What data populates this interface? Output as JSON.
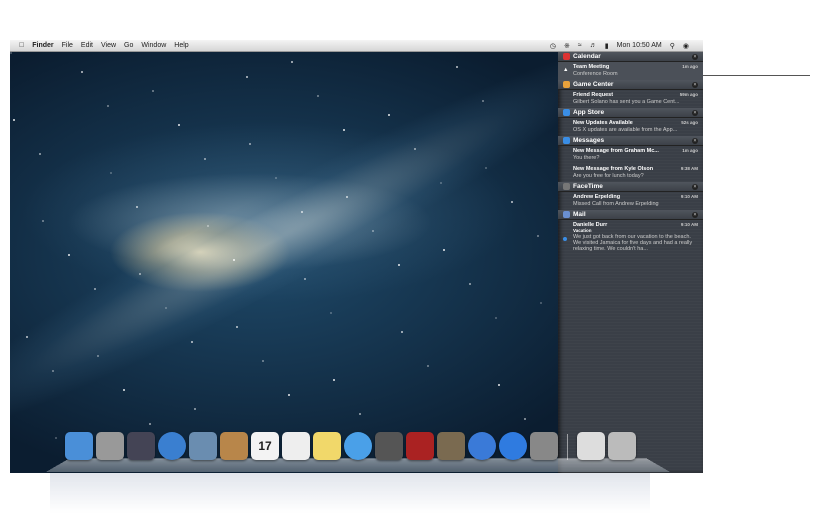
{
  "menubar": {
    "app": "Finder",
    "items": [
      "File",
      "Edit",
      "View",
      "Go",
      "Window",
      "Help"
    ],
    "clock": "Mon 10:50 AM"
  },
  "notifications": [
    {
      "app": "Calendar",
      "color": "#d33",
      "items": [
        {
          "title": "Team Meeting",
          "time": "1m ago",
          "body": "Conference Room"
        }
      ]
    },
    {
      "app": "Game Center",
      "color": "#e9a23b",
      "items": [
        {
          "title": "Friend Request",
          "time": "59m ago",
          "body": "Gilbert Solano has sent you a Game Cent..."
        }
      ]
    },
    {
      "app": "App Store",
      "color": "#3a8ee6",
      "items": [
        {
          "title": "New Updates Available",
          "time": "52s ago",
          "body": "OS X updates are available from the App..."
        }
      ]
    },
    {
      "app": "Messages",
      "color": "#3a8ee6",
      "items": [
        {
          "title": "New Message from Graham Mc...",
          "time": "1m ago",
          "body": "You there?"
        },
        {
          "title": "New Message from Kyle Olson",
          "time": "9:38 AM",
          "body": "Are you free for lunch today?"
        }
      ]
    },
    {
      "app": "FaceTime",
      "color": "#777",
      "items": [
        {
          "title": "Andrew Erpelding",
          "time": "9:10 AM",
          "body": "Missed Call from Andrew Erpelding"
        }
      ]
    },
    {
      "app": "Mail",
      "color": "#6a8fd0",
      "items": [
        {
          "title": "Danielle Durr",
          "time": "9:10 AM",
          "subtitle": "Vacation",
          "body": "We just got back from our vacation to the beach.  We visited Jamaica for five days and had a really relaxing time.  We couldn't ha..."
        }
      ]
    }
  ],
  "dock": [
    {
      "name": "finder",
      "color": "#4a8fd8"
    },
    {
      "name": "launchpad",
      "color": "#999"
    },
    {
      "name": "mission-control",
      "color": "#445"
    },
    {
      "name": "safari",
      "color": "#3a7fd0",
      "round": true
    },
    {
      "name": "preview",
      "color": "#6a8db0"
    },
    {
      "name": "contacts",
      "color": "#b8864a"
    },
    {
      "name": "calendar",
      "color": "#f3f3f3",
      "label": "17"
    },
    {
      "name": "reminders",
      "color": "#eee"
    },
    {
      "name": "notes",
      "color": "#f1d86a"
    },
    {
      "name": "messages",
      "color": "#4aa0e8",
      "round": true
    },
    {
      "name": "facetime",
      "color": "#555"
    },
    {
      "name": "photo-booth",
      "color": "#a22"
    },
    {
      "name": "iphoto",
      "color": "#7a6a50"
    },
    {
      "name": "itunes",
      "color": "#3a7ad8",
      "round": true
    },
    {
      "name": "app-store",
      "color": "#2f7be0",
      "round": true
    },
    {
      "name": "system-preferences",
      "color": "#888"
    },
    {
      "sep": true
    },
    {
      "name": "documents",
      "color": "#ddd"
    },
    {
      "name": "trash",
      "color": "#bbb"
    }
  ]
}
